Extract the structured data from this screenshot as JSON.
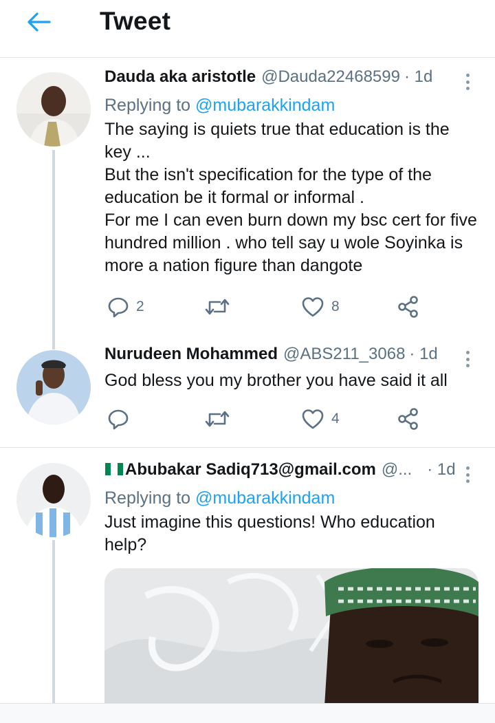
{
  "header": {
    "title": "Tweet"
  },
  "tweets": [
    {
      "name": "Dauda aka aristotle",
      "handle": "@Dauda22468599",
      "time": "· 1d",
      "replying_prefix": "Replying to ",
      "replying_to": "@mubarakkindam",
      "text_lines": [
        "The saying is quiets true that education is the",
        "key ...",
        "But the isn't specification for the type of the",
        "education be it formal or informal .",
        "For me I can even burn down my bsc cert for five",
        "hundred million . who tell say u wole Soyinka is",
        "more a nation figure than dangote"
      ],
      "replies": "2",
      "retweets": "",
      "likes": "8"
    },
    {
      "name": "Nurudeen Mohammed",
      "handle": "@ABS211_3068",
      "time": "· 1d",
      "text_lines": [
        "God bless you my brother you have said it all"
      ],
      "replies": "",
      "retweets": "",
      "likes": "4"
    },
    {
      "name": "Abubakar Sadiq713@gmail.com",
      "handle": "@...",
      "time": "· 1d",
      "replying_prefix": "Replying to ",
      "replying_to": "@mubarakkindam",
      "text_lines": [
        "Just imagine this questions! Who education",
        "help?"
      ]
    }
  ],
  "colors": {
    "accent": "#1da1f2",
    "secondary_text": "#5b7083",
    "primary_text": "#14171a",
    "divider": "#dfe3e6"
  },
  "icons": [
    "back-arrow-icon",
    "more-icon",
    "reply-icon",
    "retweet-icon",
    "like-icon",
    "share-icon",
    "nigeria-flag-icon"
  ]
}
